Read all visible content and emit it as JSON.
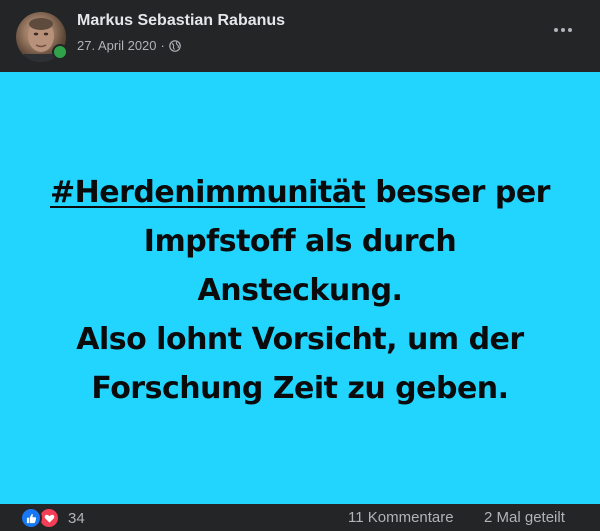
{
  "header": {
    "author_name": "Markus Sebastian Rabanus",
    "date": "27. April 2020",
    "separator": "·",
    "privacy_icon": "globe-icon",
    "more_icon": "more-horizontal-icon"
  },
  "post_image": {
    "background_color": "#22d5ff",
    "hashtag": "#Herdenimmunität",
    "line1_rest": " besser per",
    "line2": "Impfstoff als durch",
    "line3": "Ansteckung.",
    "line4": "Also lohnt Vorsicht, um der",
    "line5": "Forschung Zeit zu geben."
  },
  "footer": {
    "reaction_icons": [
      "like-icon",
      "love-icon"
    ],
    "reaction_count": "34",
    "comments": "11 Kommentare",
    "shares": "2 Mal geteilt"
  },
  "colors": {
    "background": "#242526",
    "primary_text": "#e4e6eb",
    "secondary_text": "#b0b3b8",
    "online": "#31a24c",
    "like": "#1877f2",
    "love": "#f33e58"
  }
}
